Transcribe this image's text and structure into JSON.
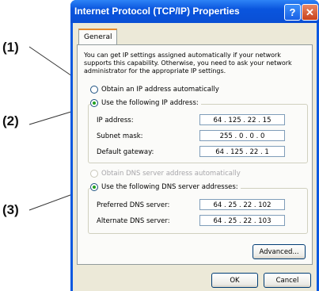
{
  "callouts": {
    "c1": "(1)",
    "c2": "(2)",
    "c3": "(3)"
  },
  "window": {
    "title": "Internet Protocol (TCP/IP) Properties",
    "help_glyph": "?",
    "close_glyph": "✕"
  },
  "tab": {
    "label": "General"
  },
  "intro": "You can get IP settings assigned automatically if your network supports this capability. Otherwise, you need to ask your network administrator for the appropriate IP settings.",
  "ip": {
    "auto_label": "Obtain an IP address automatically",
    "manual_label": "Use the following IP address:",
    "fields": [
      {
        "label": "IP address:",
        "value": "64 . 125 . 22 . 15"
      },
      {
        "label": "Subnet mask:",
        "value": "255 . 0 . 0 . 0"
      },
      {
        "label": "Default gateway:",
        "value": "64 . 125 . 22 . 1"
      }
    ]
  },
  "dns": {
    "auto_label": "Obtain DNS server address automatically",
    "manual_label": "Use the following DNS server addresses:",
    "fields": [
      {
        "label": "Preferred DNS server:",
        "value": "64 . 25 . 22 . 102"
      },
      {
        "label": "Alternate DNS server:",
        "value": "64 . 25 . 22 . 103"
      }
    ]
  },
  "buttons": {
    "advanced": "Advanced...",
    "ok": "OK",
    "cancel": "Cancel"
  },
  "colors": {
    "titlebar": "#0a55de",
    "dialog_bg": "#ece9d8",
    "radio_dot": "#21a121",
    "close": "#c9421b"
  }
}
